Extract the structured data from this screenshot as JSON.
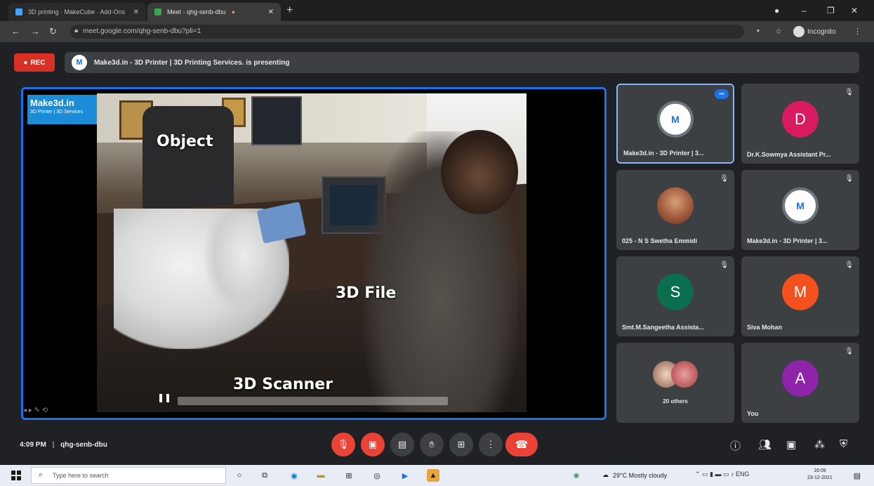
{
  "browser": {
    "tabs": [
      {
        "label": "3D printing · MakeCube · Add-Ons"
      },
      {
        "label": "Meet - qhg-senb-dbu"
      }
    ],
    "new_tab_label": "+",
    "url": "meet.google.com/qhg-senb-dbu?pli=1",
    "profile_label": "Incognito"
  },
  "meet": {
    "rec_label": "REC",
    "presenting_text": "Make3d.in - 3D Printer | 3D Printing Services. is presenting",
    "presenting_logo": "M",
    "stage": {
      "brand_title": "Make3d.in",
      "brand_sub": "3D Printer | 3D Services",
      "labels": {
        "object": "Object",
        "file": "3D File",
        "scanner": "3D Scanner"
      },
      "video_progress": 0.0
    },
    "participants": [
      {
        "name": "Make3d.in - 3D Printer | 3...",
        "avatar": "logo",
        "initial": "M",
        "color": "#ffffff",
        "speaking": true
      },
      {
        "name": "Dr.K.Sowmya Assistant Pr...",
        "avatar": "letter",
        "initial": "D",
        "color": "#d81b60"
      },
      {
        "name": "025 - N S Swetha Emmidi",
        "avatar": "photo",
        "initial": ""
      },
      {
        "name": "Make3d.in - 3D Printer | 3...",
        "avatar": "logo",
        "initial": "M",
        "color": "#ffffff"
      },
      {
        "name": "Smt.M.Sangeetha Assista...",
        "avatar": "letter",
        "initial": "S",
        "color": "#0b6e4f"
      },
      {
        "name": "Siva Mohan",
        "avatar": "letter",
        "initial": "M",
        "color": "#f4511e"
      },
      {
        "name": "20 others",
        "avatar": "pair",
        "initial": ""
      },
      {
        "name": "You",
        "avatar": "letter",
        "initial": "A",
        "color": "#8e24aa"
      }
    ],
    "bottom": {
      "time": "4:09 PM",
      "separator": "|",
      "meeting_code": "qhg-senb-dbu"
    }
  },
  "taskbar": {
    "search_placeholder": "Type here to search",
    "weather": "29°C Mostly cloudy",
    "clock_time": "16:09",
    "clock_date": "23-12-2021"
  },
  "colors": {
    "accent": "#1a73e8",
    "danger": "#ea4335",
    "tile_bg": "#3c4043"
  }
}
